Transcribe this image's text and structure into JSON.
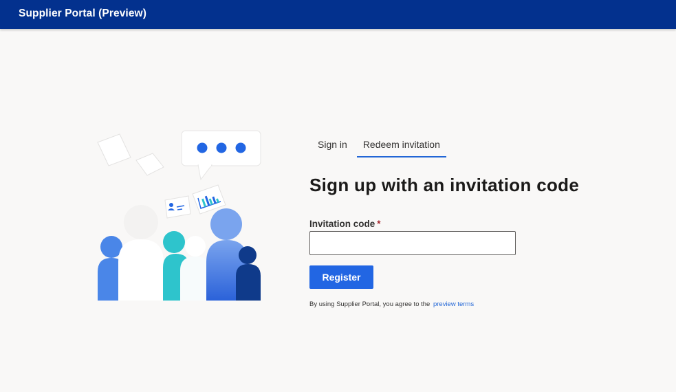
{
  "header": {
    "app_title": "Supplier Portal (Preview)"
  },
  "tabs": [
    {
      "label": "Sign in",
      "active": false
    },
    {
      "label": "Redeem invitation",
      "active": true
    }
  ],
  "form": {
    "heading": "Sign up with an invitation code",
    "field_label": "Invitation code",
    "required_marker": "*",
    "input_value": "",
    "submit_label": "Register"
  },
  "terms": {
    "text": "By using Supplier Portal, you agree to the",
    "link_label": "preview terms"
  },
  "colors": {
    "header_bg": "#03318e",
    "accent": "#2266e3",
    "page_bg": "#f9f8f7"
  }
}
